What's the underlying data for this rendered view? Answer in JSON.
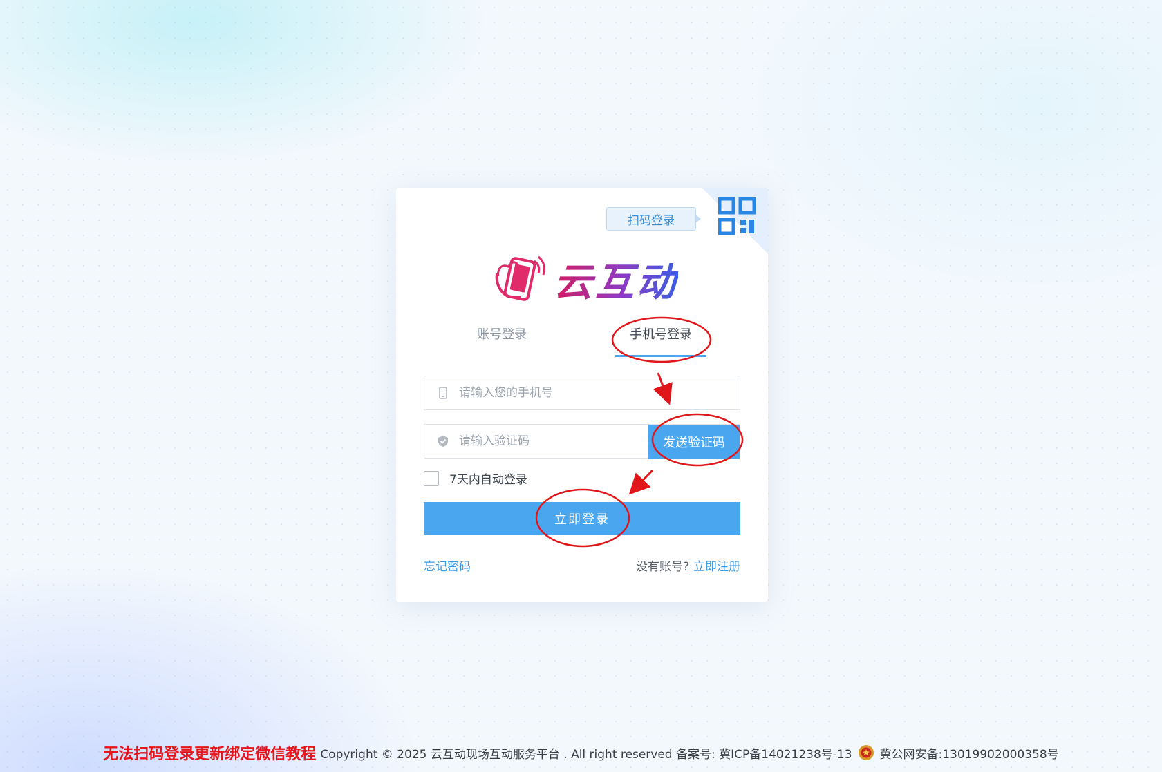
{
  "qr_login": {
    "tip": "扫码登录",
    "icon": "qr-code-icon"
  },
  "logo": {
    "text": "云互动",
    "icon": "phone-hand-icon"
  },
  "tabs": [
    {
      "label": "账号登录",
      "active": false
    },
    {
      "label": "手机号登录",
      "active": true
    }
  ],
  "phone_field": {
    "placeholder": "请输入您的手机号",
    "value": "",
    "icon": "mobile-icon"
  },
  "code_field": {
    "placeholder": "请输入验证码",
    "value": "",
    "icon": "shield-check-icon"
  },
  "send_code_label": "发送验证码",
  "remember": {
    "label": "7天内自动登录",
    "checked": false
  },
  "login_label": "立即登录",
  "forgot_label": "忘记密码",
  "no_account_label": "没有账号?",
  "register_label": "立即注册",
  "footer": {
    "tutorial_link": "无法扫码登录更新绑定微信教程",
    "copyright": "Copyright © 2025 云互动现场互动服务平台 . All right reserved 备案号: 冀ICP备14021238号-13",
    "police_record": "冀公网安备:13019902000358号"
  },
  "colors": {
    "accent": "#4aa7ef",
    "link": "#3a9be5",
    "annotation": "#e0161b",
    "footer_link": "#e6141b"
  }
}
